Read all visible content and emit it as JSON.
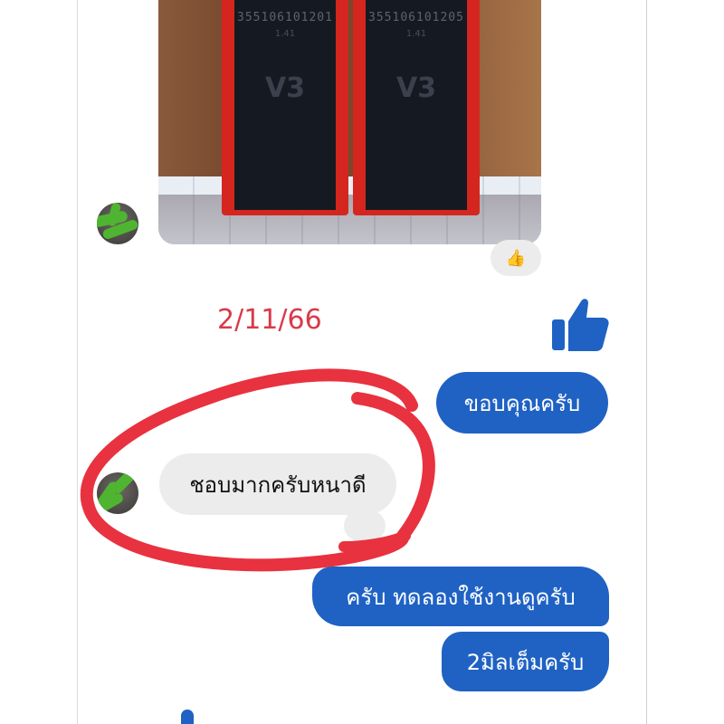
{
  "photo": {
    "cards": [
      {
        "serial": "355106101201",
        "sub": "1.41",
        "version": "V3"
      },
      {
        "serial": "355106101205",
        "sub": "1.41",
        "version": "V3"
      }
    ]
  },
  "photo_reaction": {
    "emoji": "👍"
  },
  "annotation": {
    "date": "2/11/66",
    "circle_color": "#e8323f"
  },
  "like_icon": {
    "name": "thumbs-up-icon",
    "color": "#1f62c4"
  },
  "messages": {
    "out_1": "ขอบคุณครับ",
    "in_1": "ชอบมากครับหนาดี",
    "out_2": "ครับ ทดลองใช้งานดูครับ",
    "out_3": "2มิลเต็มครับ"
  },
  "colors": {
    "outgoing_bubble": "#1f62c4",
    "incoming_bubble": "#ececec",
    "date_text": "#d93a48"
  }
}
